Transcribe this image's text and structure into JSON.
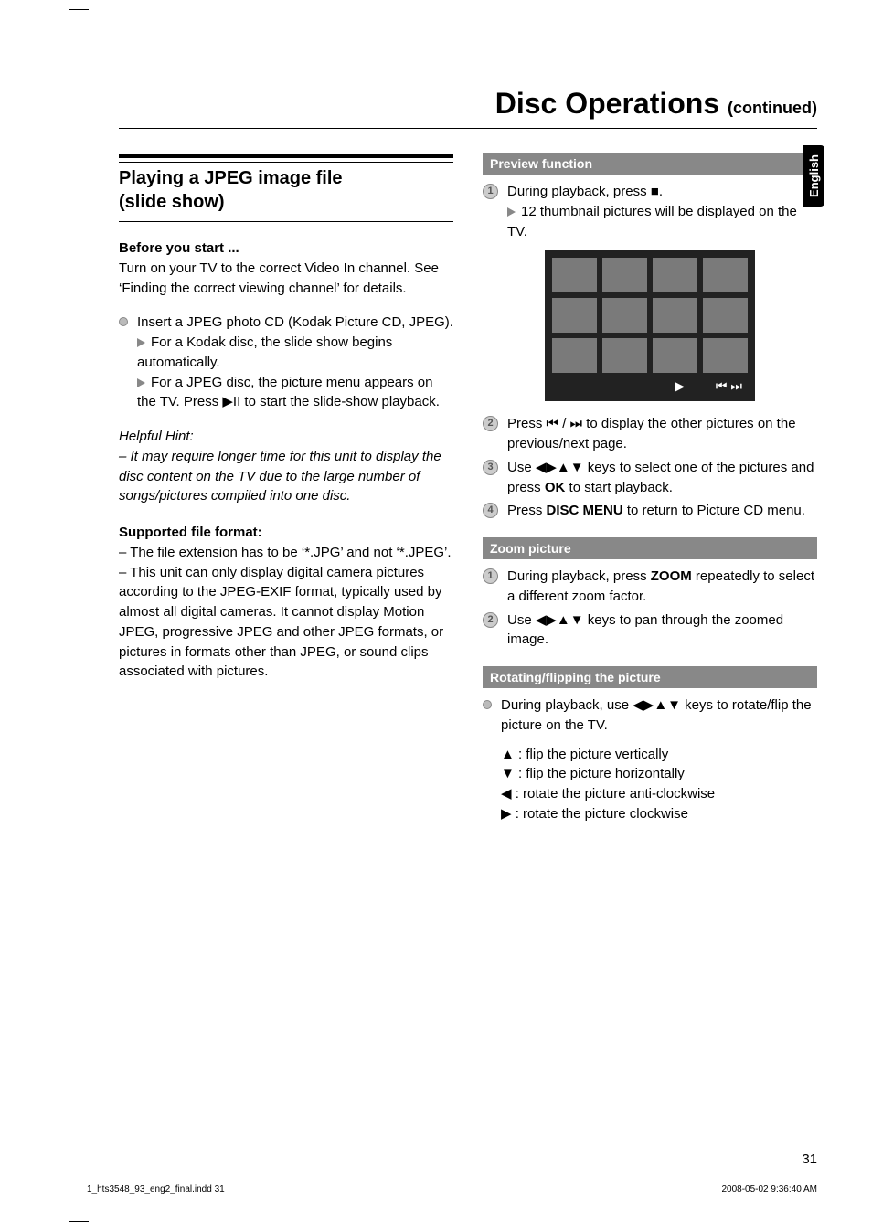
{
  "title": "Disc Operations",
  "title_suffix": "(continued)",
  "edge_tab": "English",
  "page_number": "31",
  "footer_left": "1_hts3548_93_eng2_final.indd   31",
  "footer_right": "2008-05-02   9:36:40 AM",
  "left": {
    "section_heading_l1": "Playing a JPEG image file",
    "section_heading_l2": "(slide show)",
    "before_heading": "Before you start ...",
    "before_text": "Turn on your TV to the correct Video In channel. See ‘Finding the correct viewing channel’ for details.",
    "insert_text": "Insert a JPEG photo CD (Kodak Picture CD, JPEG).",
    "insert_sub1": "For a Kodak disc, the slide show begins automatically.",
    "insert_sub2_a": "For a JPEG disc, the picture menu appears on the TV. Press ",
    "insert_sub2_b": " to start the slide-show playback.",
    "hint_heading": "Helpful Hint:",
    "hint_body": "– It may require longer time for this unit to display the disc content on the TV due to the large number of songs/pictures compiled into one disc.",
    "supported_heading": "Supported file format:",
    "supported_1": "– The file extension has to be ‘*.JPG’ and not ‘*.JPEG’.",
    "supported_2": "– This unit can only display digital camera pictures according to the JPEG-EXIF format, typically used by almost all digital cameras. It cannot display Motion JPEG, progressive JPEG and other JPEG formats, or pictures in formats other than JPEG, or sound clips associated with pictures."
  },
  "right": {
    "preview_heading": "Preview function",
    "preview_step1_a": "During playback, press ",
    "preview_step1_b": ".",
    "preview_step1_sub": "12 thumbnail pictures will be displayed on the TV.",
    "preview_step2_a": "Press ",
    "preview_step2_b": " / ",
    "preview_step2_c": " to display the other pictures on the previous/next page.",
    "preview_step3_a": "Use ",
    "preview_step3_b": " keys to select one of the pictures and press ",
    "preview_step3_ok": "OK",
    "preview_step3_c": " to start playback.",
    "preview_step4_a": "Press ",
    "preview_step4_b": "DISC MENU",
    "preview_step4_c": " to return to Picture CD menu.",
    "zoom_heading": "Zoom picture",
    "zoom_step1_a": "During playback, press ",
    "zoom_step1_b": "ZOOM",
    "zoom_step1_c": " repeatedly to select a different zoom factor.",
    "zoom_step2_a": "Use ",
    "zoom_step2_b": " keys to pan through the zoomed image.",
    "rotate_heading": "Rotating/flipping the picture",
    "rotate_intro_a": "During playback, use ",
    "rotate_intro_b": " keys to rotate/flip the picture on the TV.",
    "rot_up": " : flip the picture vertically",
    "rot_down": " : flip the picture horizontally",
    "rot_left": " : rotate the picture anti-clockwise",
    "rot_right": " : rotate the picture clockwise"
  },
  "sym": {
    "play_pause": "▶II",
    "stop": "■",
    "prev": "⏮",
    "next": "⏭",
    "arrows4": "◀▶▲▼",
    "up": "▲",
    "down": "▼",
    "left": "◀",
    "right": "▶",
    "play": "▶",
    "prevnext": "⏮ ⏭"
  }
}
